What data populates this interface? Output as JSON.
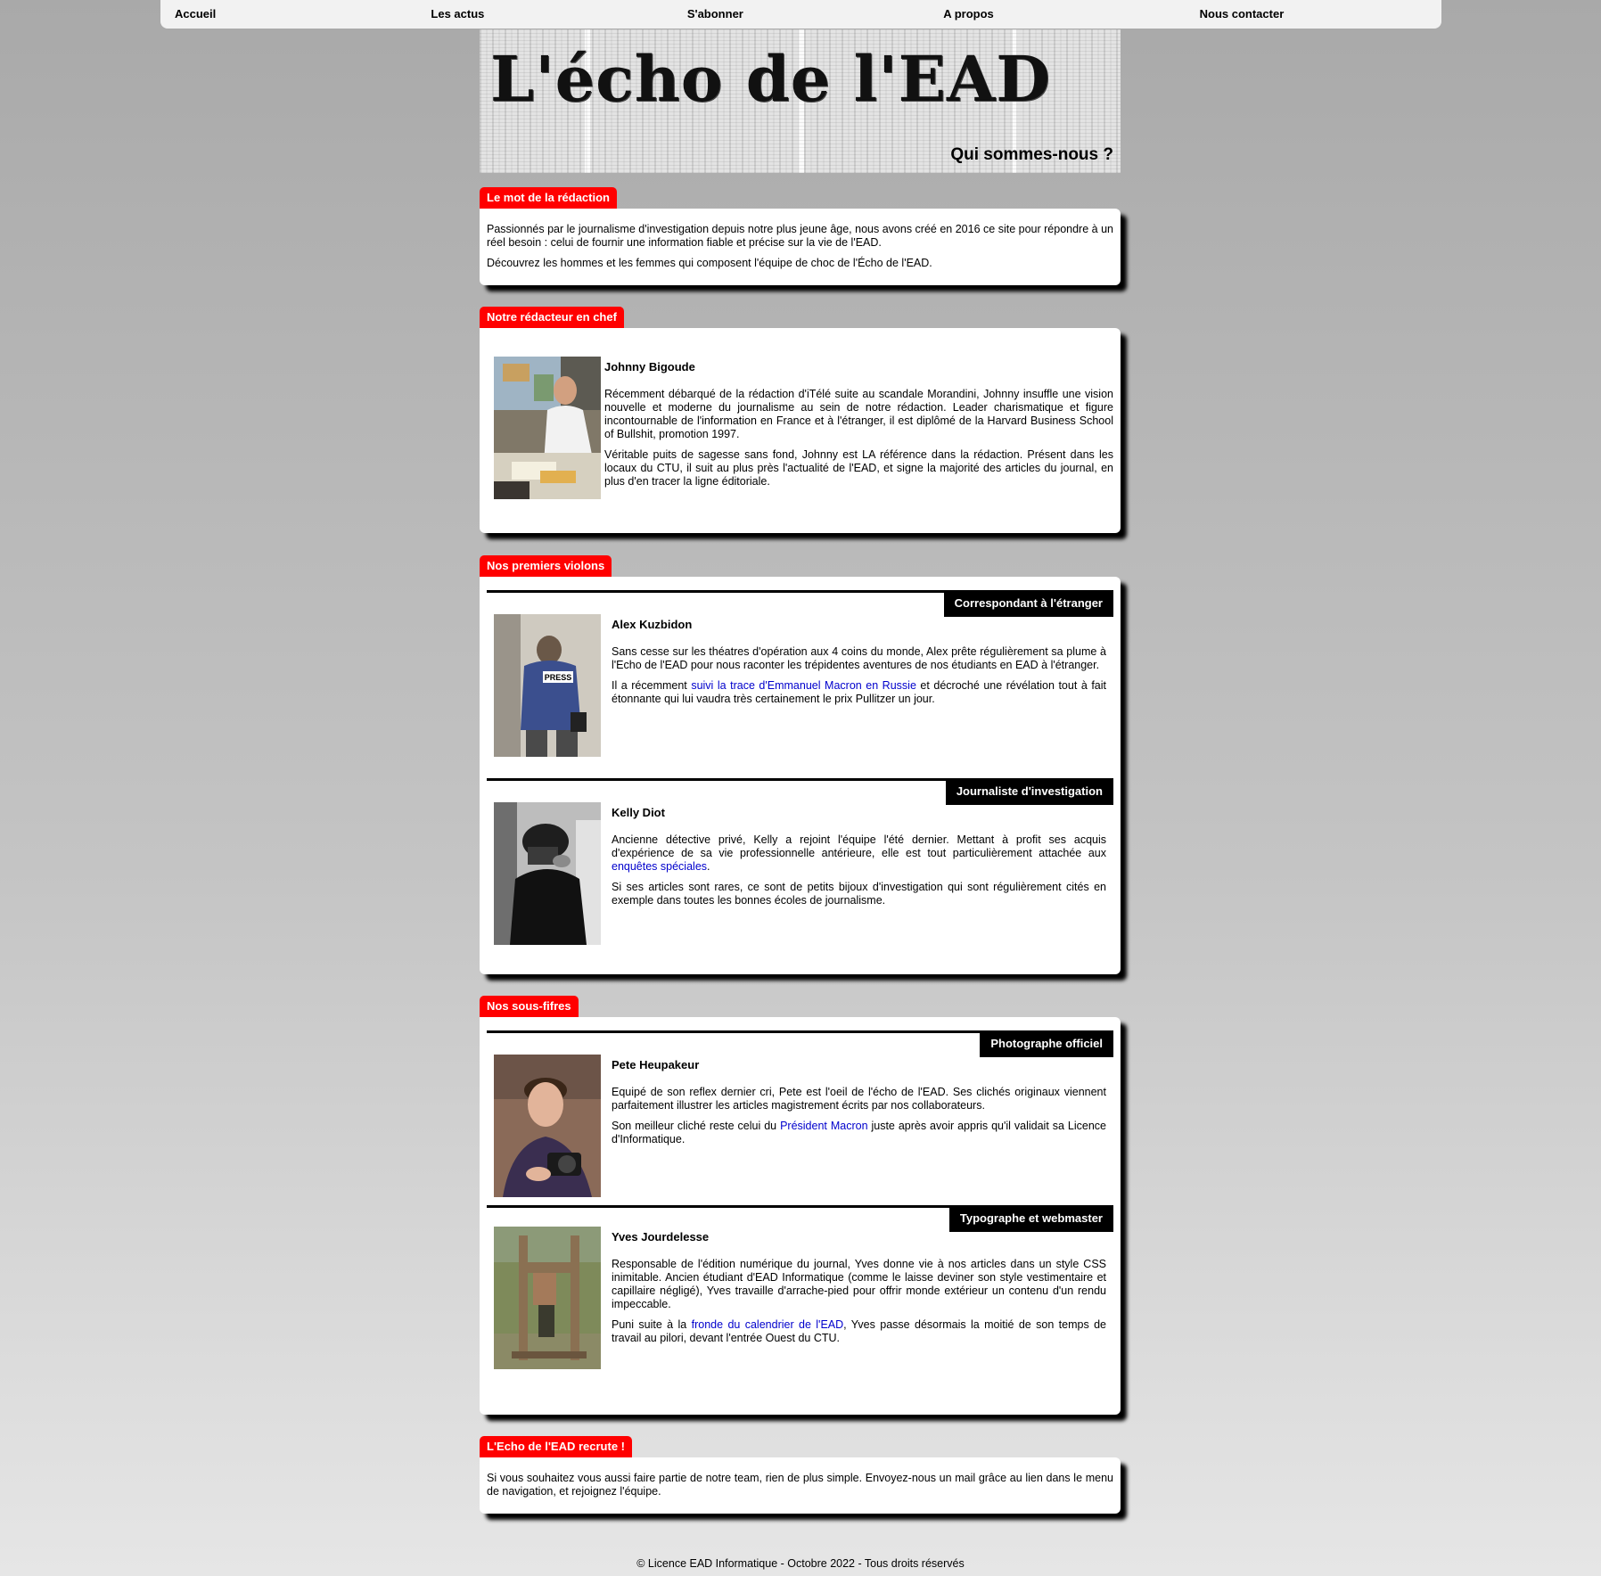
{
  "nav": {
    "items": [
      "Accueil",
      "Les actus",
      "S'abonner",
      "A propos",
      "Nous contacter"
    ]
  },
  "header": {
    "logo": "L'écho de l'EAD",
    "subtitle": "Qui sommes-nous ?"
  },
  "mot": {
    "title": "Le mot de la rédaction",
    "p1": "Passionnés par le journalisme d'investigation depuis notre plus jeune âge, nous avons créé en 2016 ce site pour répondre à un réel besoin : celui de fournir une information fiable et précise sur la vie de l'EAD.",
    "p2": "Découvrez les hommes et les femmes qui composent l'équipe de choc de l'Écho de l'EAD."
  },
  "chef": {
    "title": "Notre rédacteur en chef",
    "name": "Johnny Bigoude",
    "p1": "Récemment débarqué de la rédaction d'iTélé suite au scandale Morandini, Johnny insuffle une vision nouvelle et moderne du journalisme au sein de notre rédaction. Leader charismatique et figure incontournable de l'information en France et à l'étranger, il est diplômé de la Harvard Business School of Bullshit, promotion 1997.",
    "p2": "Véritable puits de sagesse sans fond, Johnny est LA référence dans la rédaction. Présent dans les locaux du CTU, il suit au plus près l'actualité de l'EAD, et signe la majorité des articles du journal, en plus d'en tracer la ligne éditoriale."
  },
  "violons": {
    "title": "Nos premiers violons",
    "alex": {
      "role": "Correspondant à l'étranger",
      "name": "Alex Kuzbidon",
      "p1": "Sans cesse sur les théatres d'opération aux 4 coins du monde, Alex prête régulièrement sa plume à l'Echo de l'EAD pour nous raconter les trépidentes aventures de nos étudiants en EAD à l'étranger.",
      "p2_before": "Il a récemment ",
      "p2_link": "suivi la trace d'Emmanuel Macron en Russie",
      "p2_after": " et décroché une révélation tout à fait étonnante qui lui vaudra très certainement le prix Pullitzer un jour."
    },
    "kelly": {
      "role": "Journaliste d'investigation",
      "name": "Kelly Diot",
      "p1_before": "Ancienne détective privé, Kelly a rejoint l'équipe l'été dernier. Mettant à profit ses acquis d'expérience de sa vie professionnelle antérieure, elle est tout particulièrement attachée aux ",
      "p1_link": "enquêtes spéciales",
      "p1_after": ".",
      "p2": "Si ses articles sont rares, ce sont de petits bijoux d'investigation qui sont régulièrement cités en exemple dans toutes les bonnes écoles de journalisme."
    }
  },
  "sousfifres": {
    "title": "Nos sous-fifres",
    "pete": {
      "role": "Photographe officiel",
      "name": "Pete Heupakeur",
      "p1": "Equipé de son reflex dernier cri, Pete est l'oeil de l'écho de l'EAD. Ses clichés originaux viennent parfaitement illustrer les articles magistrement écrits par nos collaborateurs.",
      "p2_before": "Son meilleur cliché reste celui du ",
      "p2_link": "Président Macron",
      "p2_after": " juste après avoir appris qu'il validait sa Licence d'Informatique."
    },
    "yves": {
      "role": "Typographe et webmaster",
      "name": "Yves Jourdelesse",
      "p1": "Responsable de l'édition numérique du journal, Yves donne vie à nos articles dans un style CSS inimitable. Ancien étudiant d'EAD Informatique (comme le laisse deviner son style vestimentaire et capillaire négligé), Yves travaille d'arrache-pied pour offrir monde extérieur un contenu d'un rendu impeccable.",
      "p2_before": "Puni suite à la ",
      "p2_link": "fronde du calendrier de l'EAD",
      "p2_after": ", Yves passe désormais la moitié de son temps de travail au pilori, devant l'entrée Ouest du CTU."
    }
  },
  "recrute": {
    "title": "L'Echo de l'EAD recrute !",
    "p1": "Si vous souhaitez vous aussi faire partie de notre team, rien de plus simple. Envoyez-nous un mail grâce au lien dans le menu de navigation, et rejoignez l'équipe."
  },
  "footer": {
    "text": "© Licence EAD Informatique - Octobre 2022 - Tous droits réservés"
  },
  "colors": {
    "tab_red": "#ff0000",
    "link_blue": "#0000cc",
    "role_black": "#000000"
  }
}
